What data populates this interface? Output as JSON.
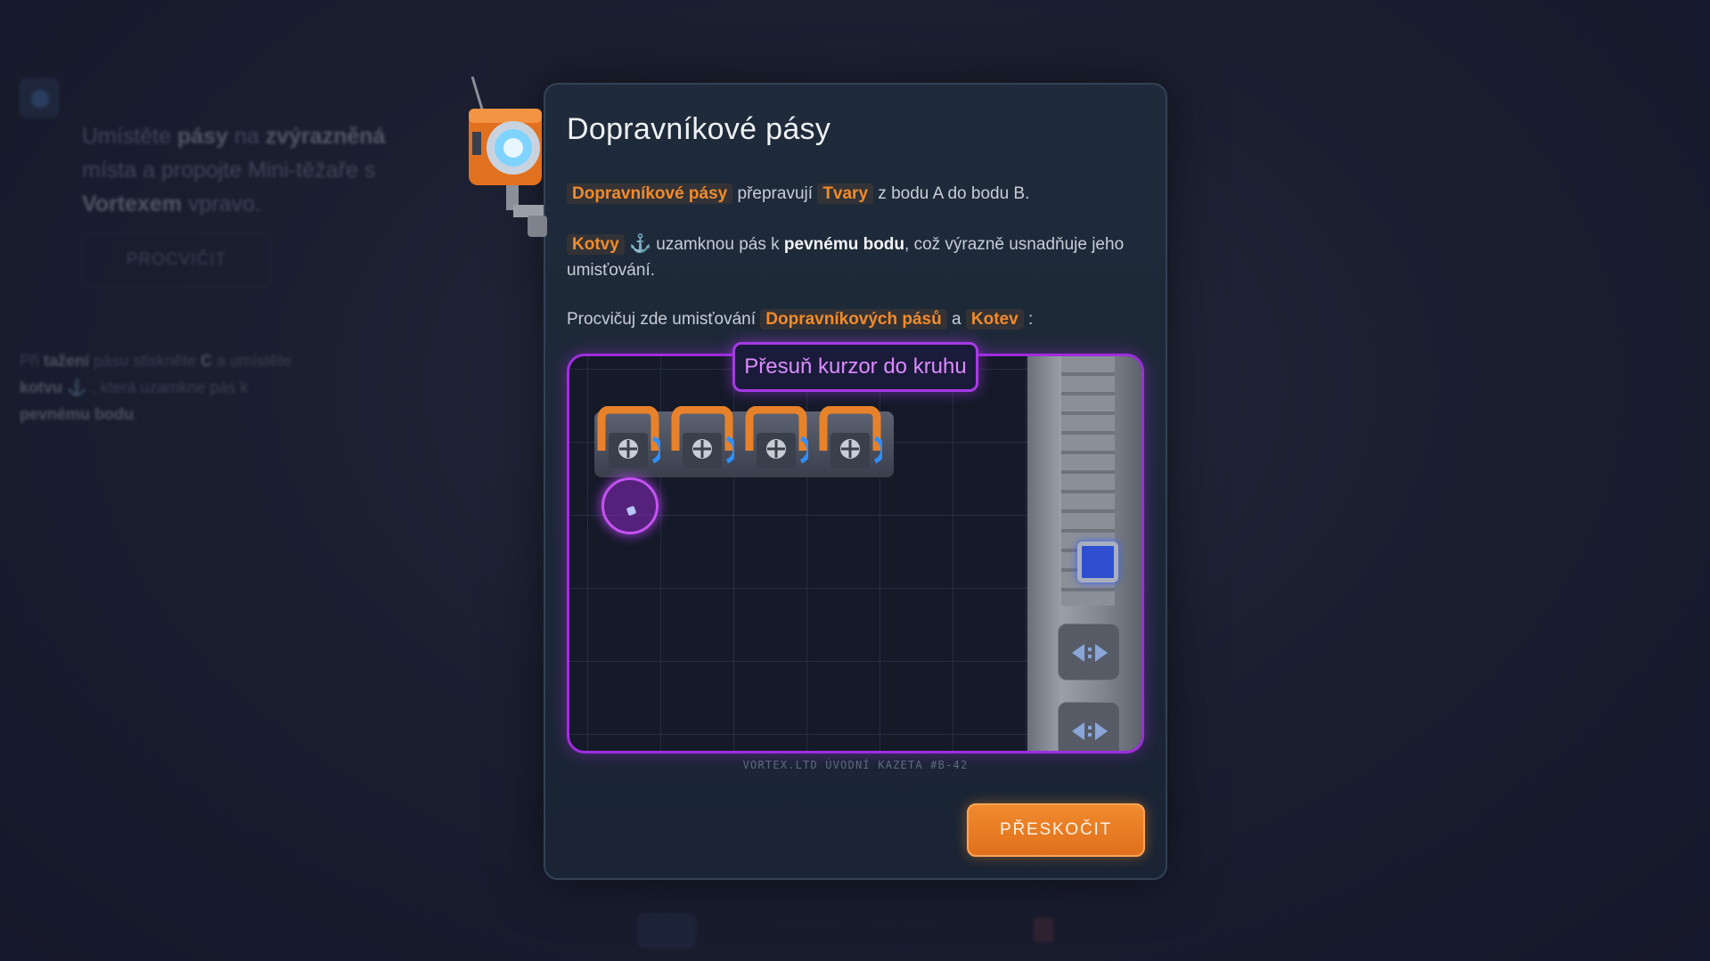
{
  "background": {
    "instruction_parts": [
      "Umístěte",
      "pásy",
      "na",
      "zvýrazněná",
      "místa a propojte Mini-těžaře s",
      "Vortexem",
      "vpravo."
    ],
    "practice_label": "PROCVIČIT",
    "hint_parts": [
      "Při",
      "tažení",
      "pásu stiskněte",
      "C",
      "a umístěte",
      "kotvu",
      "⚓",
      ", která uzamkne pás k",
      "pevnému bodu",
      "."
    ]
  },
  "modal": {
    "title": "Dopravníkové pásy",
    "p1": {
      "tag1": "Dopravníkové pásy",
      "t1": "přepravují",
      "tag2": "Tvary",
      "t2": "z bodu A do bodu B."
    },
    "p2": {
      "tag1": "Kotvy",
      "anchor": "⚓",
      "t1": "uzamknou pás k",
      "bold": "pevnému bodu",
      "t2": ", což výrazně usnadňuje jeho umisťování."
    },
    "p3": {
      "t1": "Procvičuj zde umisťování",
      "tag1": "Dopravníkových pásů",
      "t2": "a",
      "tag2": "Kotev",
      "t3": ":"
    },
    "video_prompt": "Přesuň kurzor do kruhu",
    "caption": "VORTEX.LTD ÚVODNÍ KAZETA #B-42",
    "skip_label": "PŘESKOČIT"
  },
  "colors": {
    "accent_orange": "#f28b2a",
    "accent_purple": "#a12de0",
    "panel_bg": "#1f2b3a"
  }
}
